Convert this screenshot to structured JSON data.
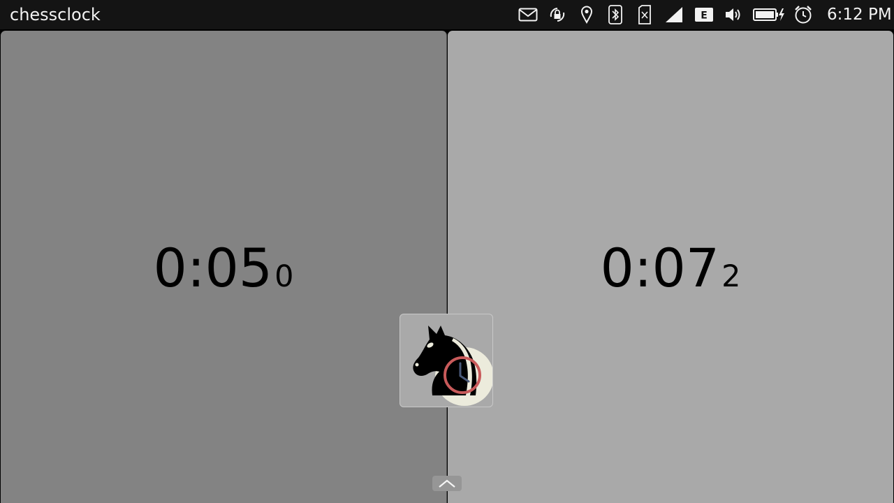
{
  "statusbar": {
    "app_title": "chessclock",
    "time": "6:12 PM",
    "network_type": "E",
    "indicators": [
      "messages-icon",
      "rotation-lock-icon",
      "location-icon",
      "bluetooth-icon",
      "no-sim-icon",
      "signal-icon",
      "network-type-icon",
      "volume-icon",
      "battery-charging-icon",
      "alarm-icon"
    ]
  },
  "players": {
    "left": {
      "time_main": "0:05",
      "time_tenths": "0",
      "color": "#838383"
    },
    "right": {
      "time_main": "0:07",
      "time_tenths": "2",
      "color": "#a9a9a9"
    }
  },
  "center_button": {
    "icon": "chess-knight-clock-icon"
  },
  "bottom": {
    "handle_icon": "chevron-up-icon"
  }
}
